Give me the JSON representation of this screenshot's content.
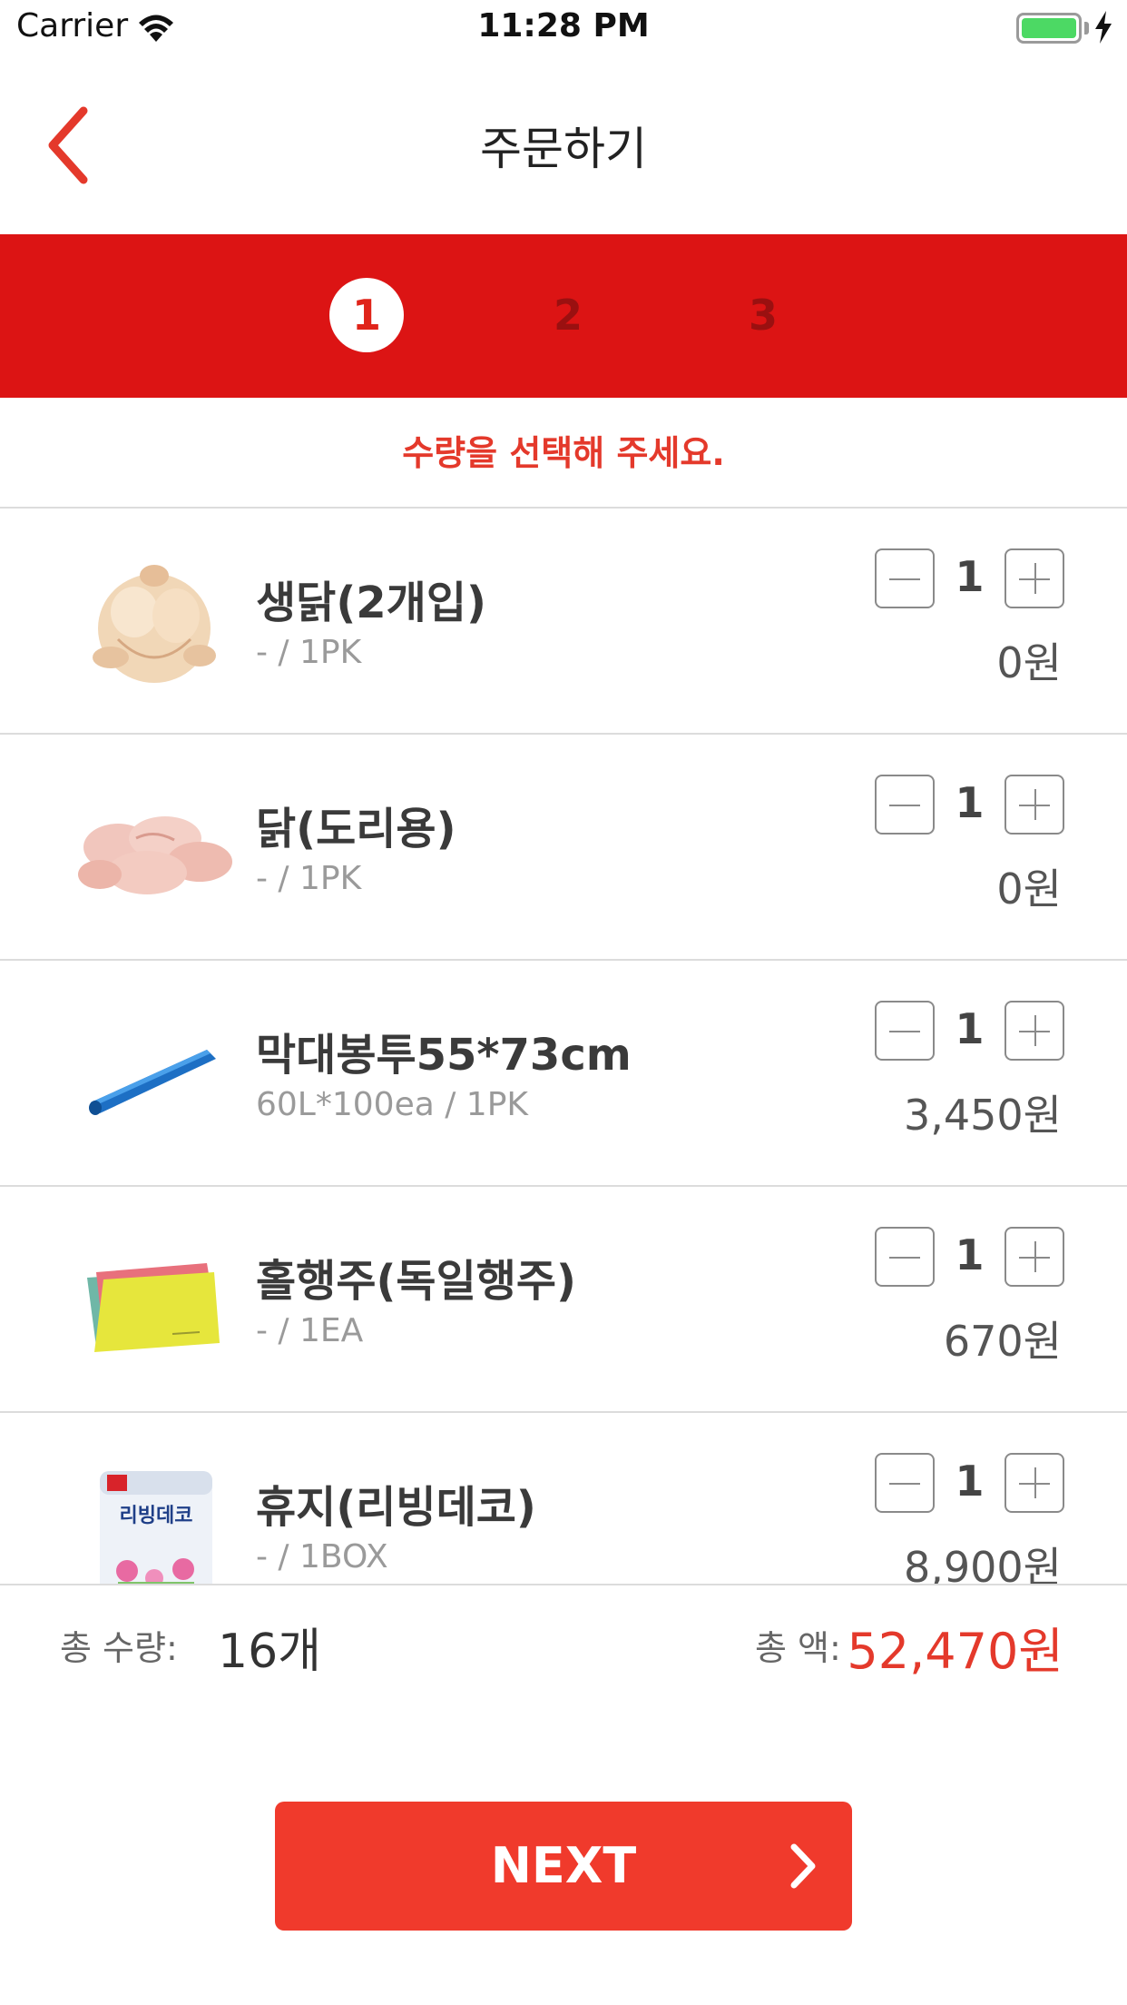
{
  "status_bar": {
    "carrier": "Carrier",
    "time": "11:28 PM",
    "battery_level": 1.0,
    "charging": true
  },
  "nav": {
    "title": "주문하기",
    "back_icon": "chevron-left-icon",
    "accent_color": "#e4392b"
  },
  "steps": {
    "items": [
      "1",
      "2",
      "3"
    ],
    "active": "1",
    "band_color": "#dc1414"
  },
  "instruction": {
    "highlight": "수량",
    "text": "을 선택해 주세요."
  },
  "items": [
    {
      "name": "생닭(2개입)",
      "spec": "- / 1PK",
      "quantity": "1",
      "price": "0원",
      "image": "whole-chicken"
    },
    {
      "name": "닭(도리용)",
      "spec": "- / 1PK",
      "quantity": "1",
      "price": "0원",
      "image": "chicken-pieces"
    },
    {
      "name": "막대봉투55*73cm",
      "spec": "60L*100ea / 1PK",
      "quantity": "1",
      "price": "3,450원",
      "image": "blue-bag-roll"
    },
    {
      "name": "홀행주(독일행주)",
      "spec": "- / 1EA",
      "quantity": "1",
      "price": "670원",
      "image": "dish-cloths"
    },
    {
      "name": "휴지(리빙데코)",
      "spec": "- / 1BOX",
      "quantity": "1",
      "price": "8,900원",
      "image": "toilet-paper-pack",
      "package_text": "리빙데코"
    }
  ],
  "summary": {
    "qty_label": "총 수량:",
    "qty_value": "16개",
    "amount_label": "총 액:",
    "amount_value": "52,470원"
  },
  "next_button": {
    "label": "NEXT",
    "icon": "chevron-right-icon",
    "color": "#f03a2c"
  }
}
